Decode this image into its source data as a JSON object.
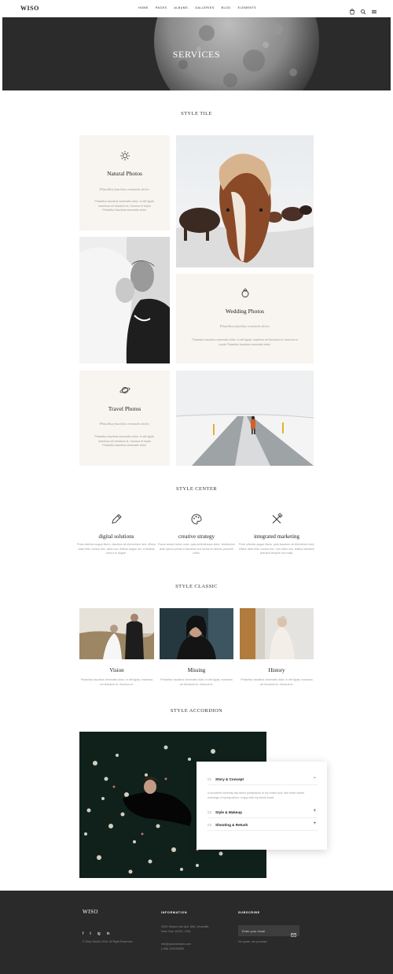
{
  "header": {
    "logo": "WISO",
    "nav": [
      "HOME",
      "PAGES",
      "ALBUMS",
      "GALLERIES",
      "BLOG",
      "ELEMENTS"
    ],
    "icons": [
      "cart-icon",
      "search-icon",
      "menu-icon"
    ]
  },
  "hero": {
    "title": "SERVICES"
  },
  "style_tile": {
    "title": "STYLE TILE",
    "items": [
      {
        "title": "Natural Photos",
        "subtitle": "Phasellus faucibus venenatis dolor.",
        "text": "Phasellus faucibus venenatis dolor. In elit ligula, maximus vel tincidunt et, rhoncus et turpis Phasellus faucibus venenatis dolor.",
        "icon": "sun-icon"
      },
      {
        "title": "Wedding Photos",
        "subtitle": "Phasellus faucibus venenatis dolor.",
        "text": "Phasellus faucibus venenatis dolor. In elit ligula, maximus vel tincidunt et, rhoncus et turpis Phasellus faucibus venenatis dolor.",
        "icon": "ring-icon"
      },
      {
        "title": "Travel Photos",
        "subtitle": "Phasellus faucibus venenatis dolor.",
        "text": "Phasellus faucibus venenatis dolor. In elit ligula, maximus vel tincidunt et, rhoncus et turpis Phasellus faucibus venenatis dolor.",
        "icon": "planet-icon"
      }
    ]
  },
  "style_center": {
    "title": "STYLE CENTER",
    "items": [
      {
        "title": "digital solutions",
        "text": "Proin ultricies augue libero, faucibus sit elementum sed, effctur vitae felis. cursus nec. diam non, finibus augue dui, a facilisis urna a in dugue.",
        "icon": "pencil-icon"
      },
      {
        "title": "creative strategy",
        "text": "Fusce auctor lorem nunc, quis pellentesque dolor. Vestibulum ante ipsum primis in faucibus orci luctus et ultrices posuere cubili.",
        "icon": "palette-icon"
      },
      {
        "title": "integrated marketing",
        "text": "Proin ultricies augue libero, quis faucibus sit elementum sed, effctur vitae felis. cursus nec. non diam non, finibus interdum posuerd tempus non nulla.",
        "icon": "tools-icon"
      }
    ]
  },
  "style_classic": {
    "title": "STYLE CLASSIC",
    "items": [
      {
        "title": "Vision",
        "text": "Phasellus faucibus venenatis dolor. In elit ligula, maximus vel tincidunt et, rhoncus et."
      },
      {
        "title": "Missing",
        "text": "Phasellus faucibus venenatis dolor. In elit ligula, maximus vel tincidunt et, rhoncus et."
      },
      {
        "title": "History",
        "text": "Phasellus faucibus venenatis dolor. In elit ligula, maximus vel tincidunt et, rhoncus et."
      }
    ]
  },
  "style_accordion": {
    "title": "STYLE ACCORDION",
    "items": [
      {
        "num": "01.",
        "label": "Story & Concept",
        "symbol": "−"
      },
      {
        "num": "02.",
        "label": "Style & Makeup",
        "symbol": "+"
      },
      {
        "num": "03.",
        "label": "Shooting & Retush",
        "symbol": "+"
      }
    ],
    "open_text": "A wonderful serenity has taken possession of my entire soul, like these sweet mornings of spring which I enjoy with my whole heart."
  },
  "footer": {
    "logo": "WISO",
    "social": [
      "f",
      "t",
      "ig",
      "in"
    ],
    "copyright": "© Wiso Studio 2018. All Right Reserved.",
    "information_title": "INFORMATION",
    "address_line1": "2005 Stokes Isle Apt. 896, Venaville,",
    "address_line2": "New York 10010, USA",
    "email": "info@yourdomain.com",
    "phone": "(+68) 120034509",
    "subscribe_title": "SUBSCRIBE",
    "email_placeholder": "Enter your email",
    "spam_note": "No spam, we promise"
  }
}
